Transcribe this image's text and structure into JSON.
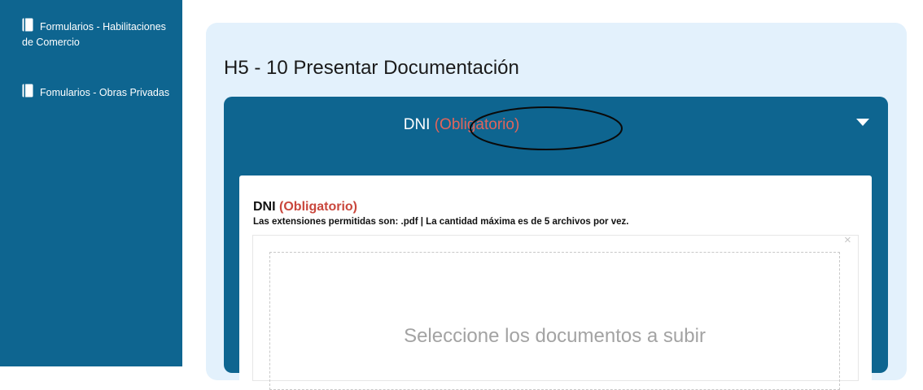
{
  "sidebar": {
    "items": [
      {
        "label": "Formularios - Habilitaciones de Comercio",
        "icon": "document-icon"
      },
      {
        "label": "Fomularios - Obras Privadas",
        "icon": "document-icon"
      }
    ]
  },
  "main": {
    "title": "H5 - 10 Presentar Documentación",
    "section": {
      "title": "DNI",
      "required_tag": "(Obligatorio)",
      "panel": {
        "label": "DNI",
        "required_tag": "(Obligatorio)",
        "help_text": "Las extensiones permitidas son: .pdf | La cantidad máxima es de 5 archivos por vez.",
        "close_symbol": "×",
        "dropzone_text": "Seleccione los documentos a subir"
      }
    }
  },
  "colors": {
    "sidebar_bg": "#0e6590",
    "content_bg": "#e3f1fc",
    "required": "#e0655c"
  }
}
